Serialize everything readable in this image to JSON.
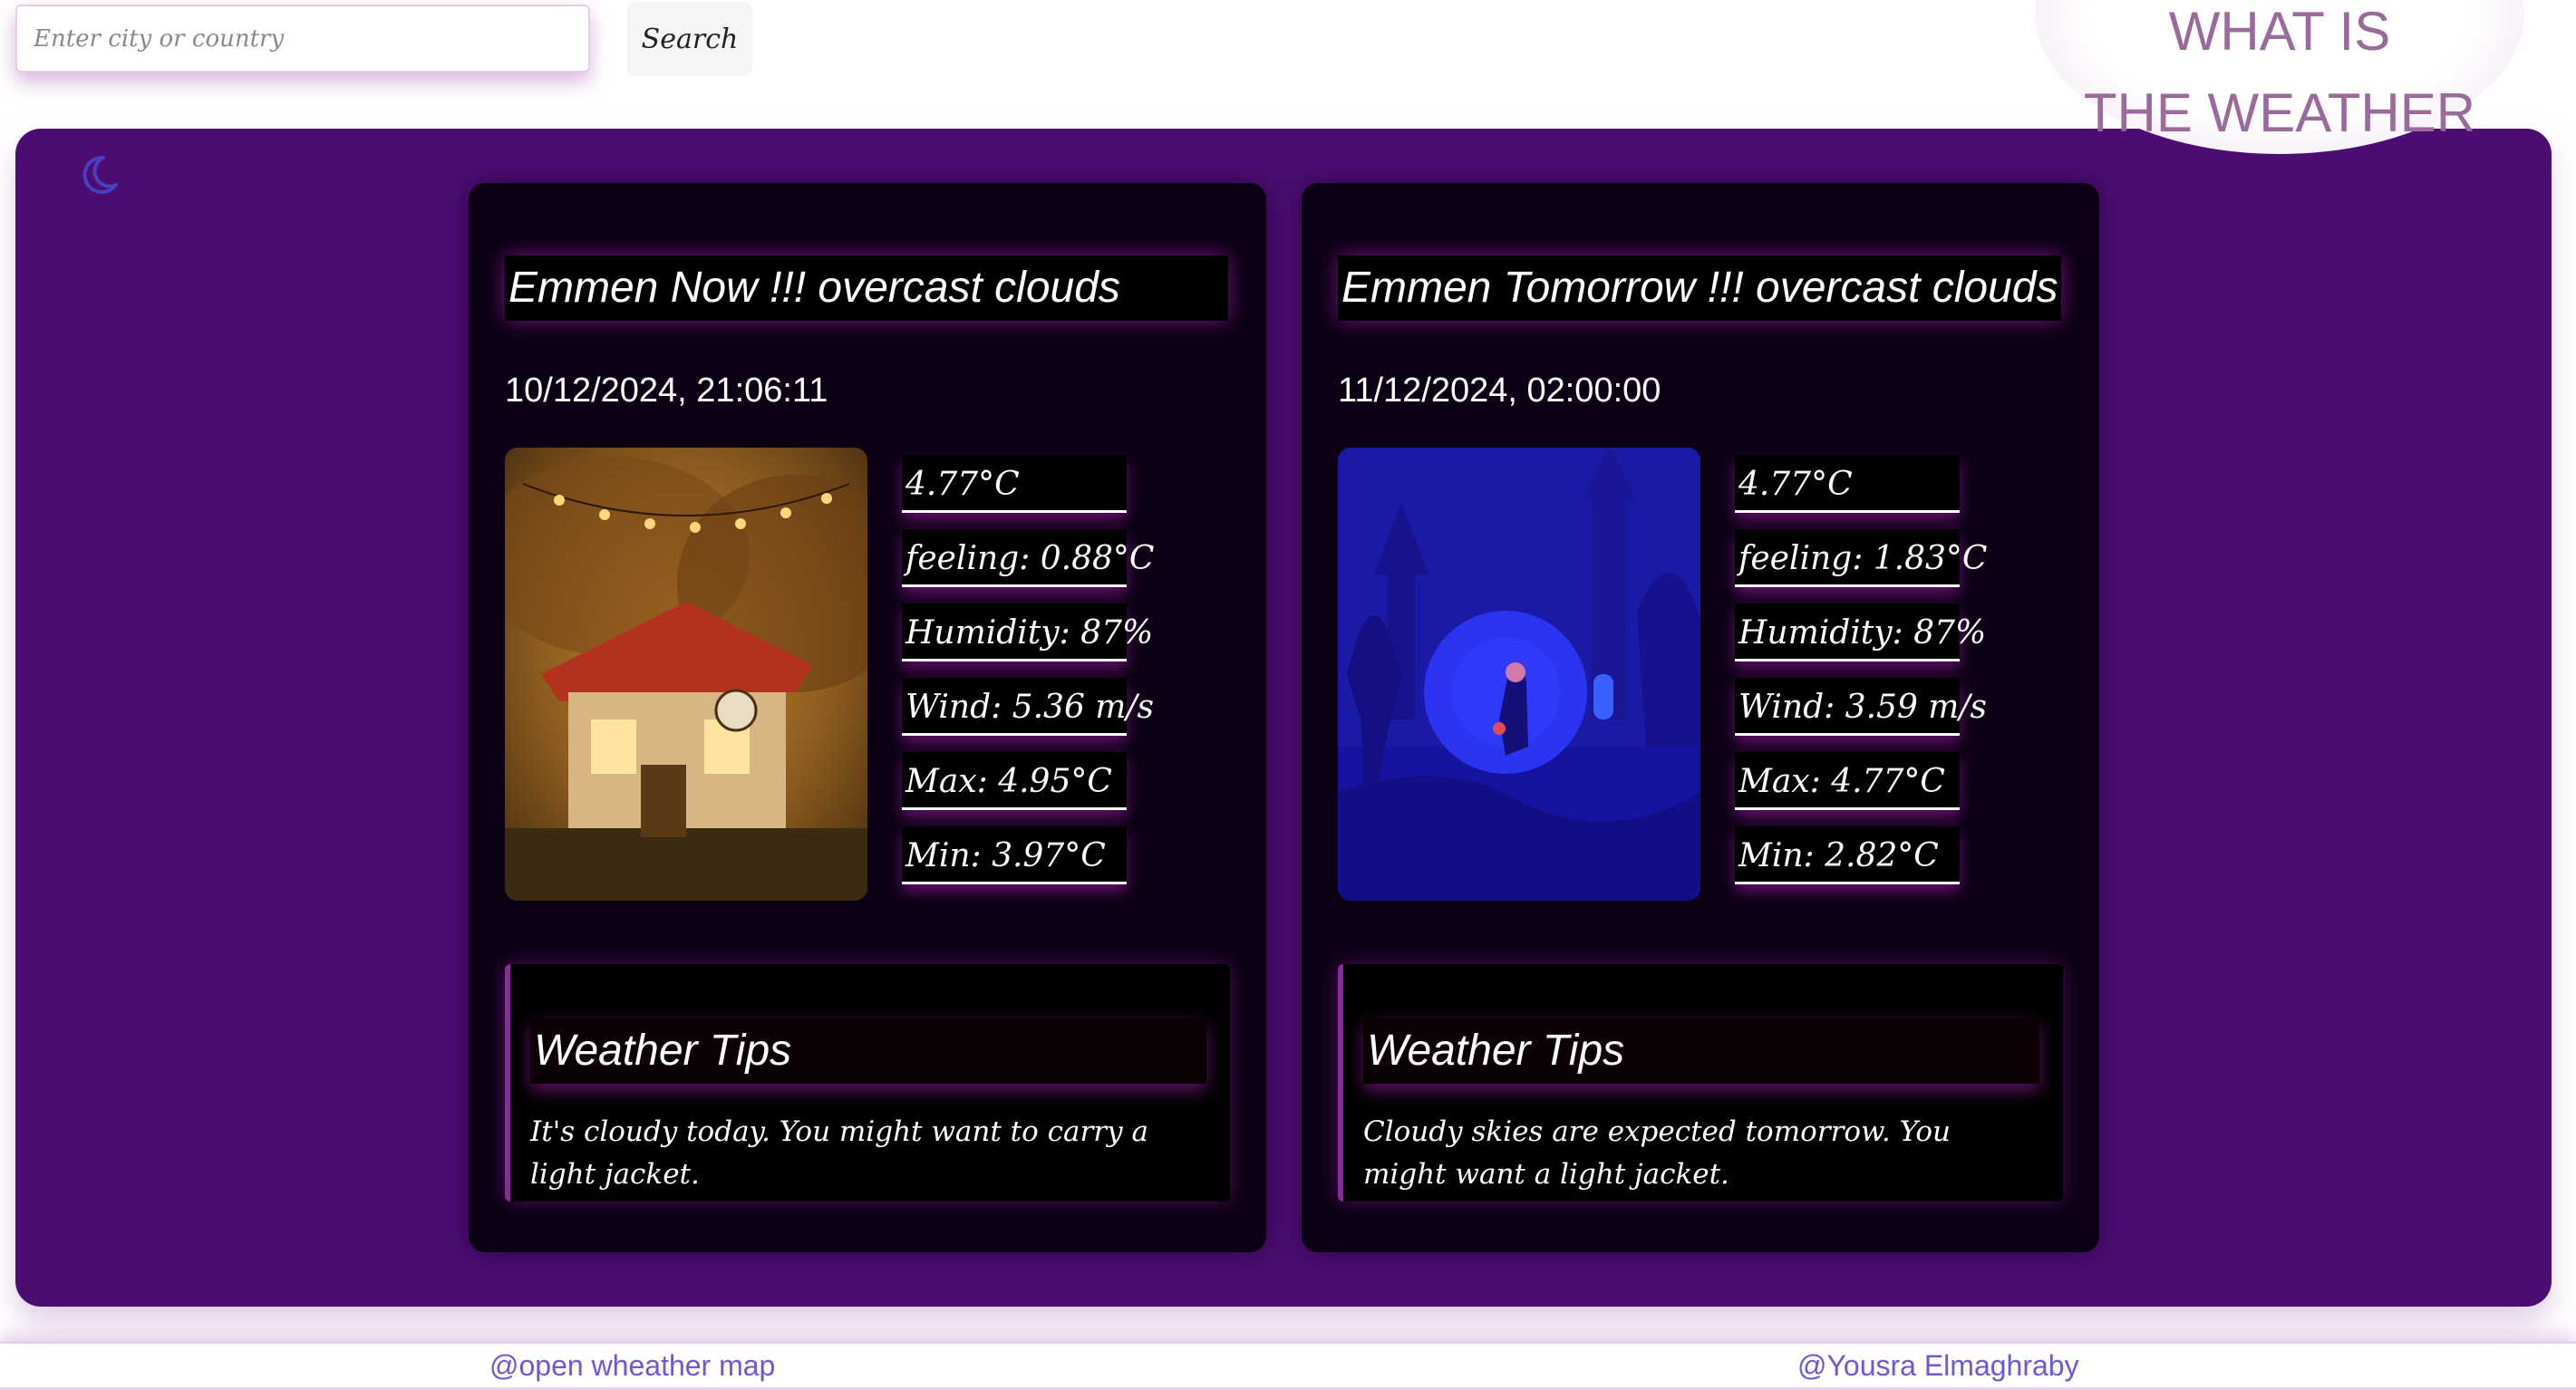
{
  "search": {
    "placeholder": "Enter city or country",
    "button_label": "Search"
  },
  "brand": {
    "line1": "WHAT IS",
    "line2": "THE WEATHER"
  },
  "theme_toggle": {
    "icon": "moon-icon",
    "color": "#4a3fc2"
  },
  "cards": [
    {
      "title": "Emmen Now !!! overcast clouds",
      "datetime": "10/12/2024, 21:06:11",
      "image_icon": "cozy-house-illustration",
      "stats": {
        "temp": "4.77°C",
        "feeling": "feeling: 0.88°C",
        "humidity": "Humidity: 87%",
        "wind": "Wind: 5.36 m/s",
        "max": "Max: 4.95°C",
        "min": "Min: 3.97°C"
      },
      "tips_title": "Weather Tips",
      "tips_text": "It's cloudy today. You might want to carry a light jacket."
    },
    {
      "title": "Emmen Tomorrow !!! overcast clouds",
      "datetime": "11/12/2024, 02:00:00",
      "image_icon": "night-forest-illustration",
      "stats": {
        "temp": "4.77°C",
        "feeling": "feeling: 1.83°C",
        "humidity": "Humidity: 87%",
        "wind": "Wind: 3.59 m/s",
        "max": "Max: 4.77°C",
        "min": "Min: 2.82°C"
      },
      "tips_title": "Weather Tips",
      "tips_text": "Cloudy skies are expected tomorrow. You might want a light jacket."
    }
  ],
  "footer": {
    "left_link": "@open wheather map",
    "right_link": "@Yousra Elmaghraby"
  },
  "colors": {
    "panel": "#4b0d72",
    "card": "#0b0014",
    "glow": "#c828d2",
    "link": "#6a5ad6",
    "brand_text": "#9a6a9a"
  }
}
